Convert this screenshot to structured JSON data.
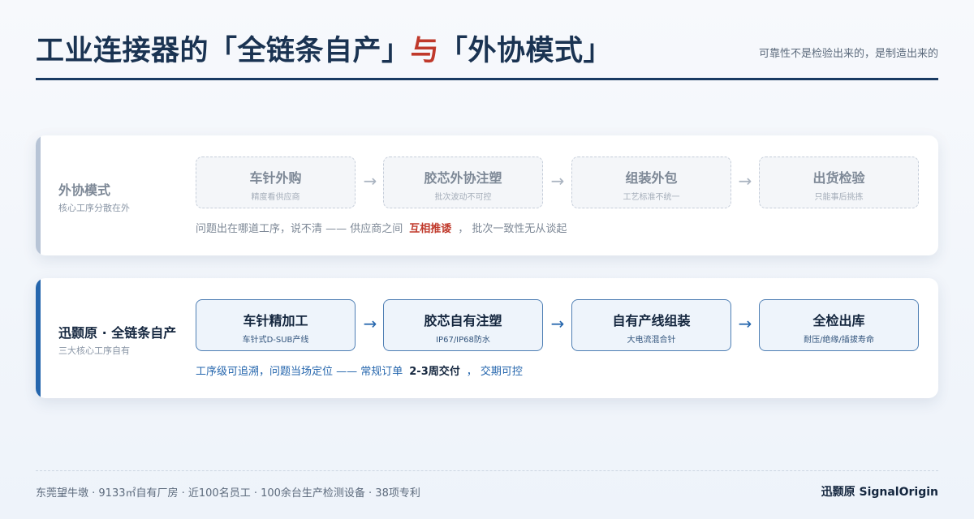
{
  "header": {
    "title_part1": "工业连接器的「全链条自产」",
    "title_accent": "与",
    "title_part2": "「外协模式」",
    "subtitle": "可靠性不是检验出来的，是制造出来的"
  },
  "rows": [
    {
      "title": "外协模式",
      "desc": "核心工序分散在外",
      "steps": [
        {
          "title": "车针外购",
          "sub": "精度看供应商"
        },
        {
          "title": "胶芯外协注塑",
          "sub": "批次波动不可控"
        },
        {
          "title": "组装外包",
          "sub": "工艺标准不统一"
        },
        {
          "title": "出货检验",
          "sub": "只能事后挑拣"
        }
      ],
      "arrow": "→",
      "note": {
        "before": "问题出在哪道工序，说不清 —— 供应商之间",
        "highlight": "互相推诿",
        "after": "， 批次一致性无从谈起"
      }
    },
    {
      "title": "迅颢原 · 全链条自产",
      "desc": "三大核心工序自有",
      "steps": [
        {
          "title": "车针精加工",
          "sub": "车针式D-SUB产线"
        },
        {
          "title": "胶芯自有注塑",
          "sub": "IP67/IP68防水"
        },
        {
          "title": "自有产线组装",
          "sub": "大电流混合针"
        },
        {
          "title": "全检出库",
          "sub": "耐压/绝缘/插拔寿命"
        }
      ],
      "arrow": "→",
      "note": {
        "before": "工序级可追溯，问题当场定位 —— 常规订单",
        "highlight": "2-3周交付",
        "after": "， 交期可控"
      }
    }
  ],
  "footer": {
    "left": "东莞望牛墩 · 9133㎡自有厂房 · 近100名员工 · 100余台生产检测设备 · 38项专利",
    "right": "迅颢原 SignalOrigin"
  },
  "colors": {
    "title": "#1a3352",
    "accent_red": "#c0392b",
    "brand_blue": "#2566ad",
    "muted_gray": "#7d8896"
  }
}
